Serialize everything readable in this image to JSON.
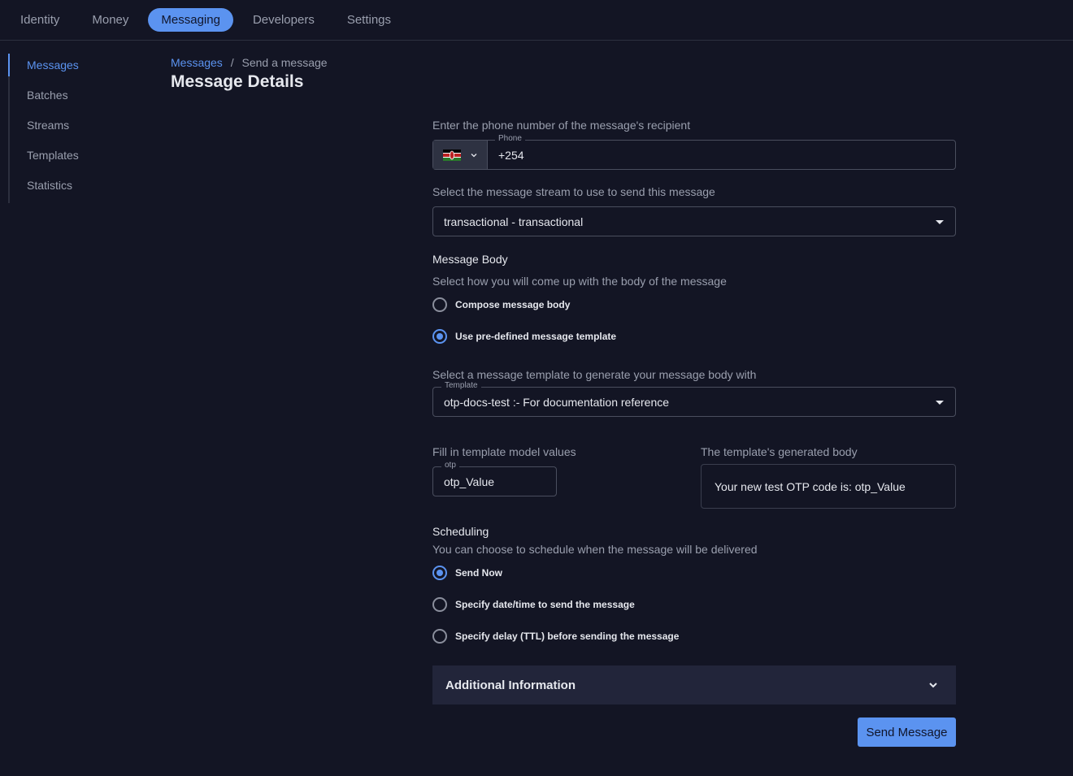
{
  "nav": {
    "tabs": [
      "Identity",
      "Money",
      "Messaging",
      "Developers",
      "Settings"
    ],
    "active": "Messaging"
  },
  "sidebar": {
    "items": [
      "Messages",
      "Batches",
      "Streams",
      "Templates",
      "Statistics"
    ],
    "active": "Messages"
  },
  "breadcrumb": {
    "parent": "Messages",
    "separator": "/",
    "current": "Send a message"
  },
  "page_title": "Message Details",
  "phone": {
    "label": "Enter the phone number of the message's recipient",
    "float": "Phone",
    "value": "+254",
    "country_icon": "kenya-flag-icon"
  },
  "stream": {
    "label": "Select the message stream to use to send this message",
    "value": "transactional - transactional"
  },
  "body": {
    "heading": "Message Body",
    "subheading": "Select how you will come up with the body of the message",
    "options": [
      "Compose message body",
      "Use pre-defined message template"
    ],
    "selected": 1
  },
  "template": {
    "label": "Select a message template to generate your message body with",
    "float": "Template",
    "value": "otp-docs-test :- For documentation reference"
  },
  "model": {
    "label": "Fill in template model values",
    "float": "otp",
    "value": "otp_Value"
  },
  "generated": {
    "label": "The template's generated body",
    "value": "Your new test OTP code is: otp_Value"
  },
  "scheduling": {
    "heading": "Scheduling",
    "subheading": "You can choose to schedule when the message will be delivered",
    "options": [
      "Send Now",
      "Specify date/time to send the message",
      "Specify delay (TTL) before sending the message"
    ],
    "selected": 0
  },
  "additional": {
    "label": "Additional Information"
  },
  "send_label": "Send Message",
  "colors": {
    "background": "#131524",
    "accent": "#5b93f0",
    "panel": "#22253a"
  }
}
